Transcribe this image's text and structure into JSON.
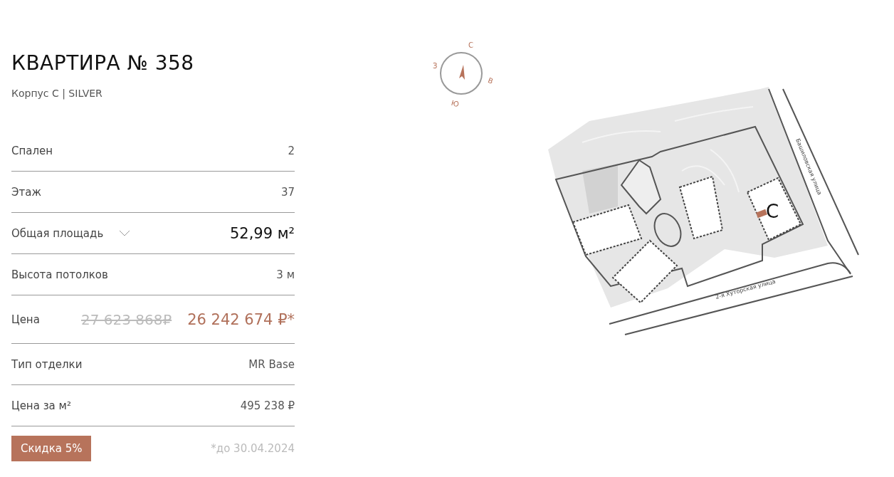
{
  "title": "КВАРТИРА № 358",
  "subtitle": "Корпус C | SILVER",
  "rows": [
    {
      "kind": "plain",
      "label": "Спален",
      "value": "2"
    },
    {
      "kind": "plain",
      "label": "Этаж",
      "value": "37"
    },
    {
      "kind": "area",
      "label": "Общая площадь",
      "value": "52,99 м²",
      "expanded": false
    },
    {
      "kind": "plain",
      "label": "Высота потолков",
      "value": "3 м"
    },
    {
      "kind": "price",
      "label": "Цена",
      "old_value": "27 623 868₽",
      "value": "26 242 674 ₽*"
    },
    {
      "kind": "plain",
      "label": "Тип отделки",
      "value": "MR Base"
    },
    {
      "kind": "plain",
      "label": "Цена за м²",
      "value": "495 238 ₽"
    }
  ],
  "discount": {
    "button": "Скидка 5%",
    "note": "*до 30.04.2024"
  },
  "compass": {
    "north": "С",
    "east": "В",
    "south": "Ю",
    "west": "З"
  },
  "site_plan": {
    "building_label": "С",
    "streets": [
      "Башиловская улица",
      "2-я Хуторская улица"
    ]
  }
}
